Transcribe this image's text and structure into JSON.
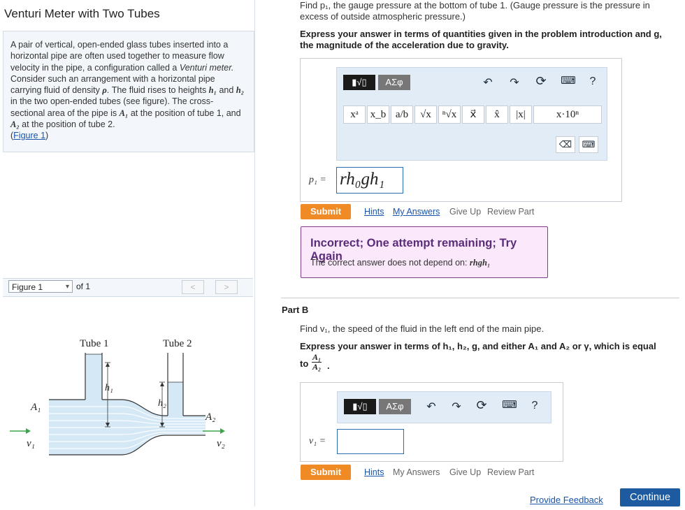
{
  "left": {
    "title": "Venturi Meter with Two Tubes",
    "intro": {
      "p1": "A pair of vertical, open-ended glass tubes inserted into a horizontal pipe are often used together to measure flow velocity in the pipe, a configuration called a ",
      "p1_italic": "Venturi meter.",
      "p2": " Consider such an arrangement with a horizontal pipe carrying fluid of density ",
      "rho": "ρ",
      "p3": ". The fluid rises to heights ",
      "h1": "h₁",
      "and": " and ",
      "h2": "h₂",
      "p4": " in the two open-ended tubes (see figure). The cross-sectional area of the pipe is ",
      "A1": "A₁",
      "p5": " at the position of tube 1, and ",
      "A2": "A₂",
      "p6": " at the position of tube 2.",
      "figure_link": "Figure 1"
    },
    "figure": {
      "selected": "Figure 1",
      "of": "of 1",
      "prev": "<",
      "next": ">",
      "tube1": "Tube 1",
      "tube2": "Tube 2",
      "h1": "h₁",
      "h2": "h₂",
      "A1": "A₁",
      "A2": "A₂",
      "v1": "v₁",
      "v2": "v₂"
    }
  },
  "partA": {
    "question": "Find p₁, the gauge pressure at the bottom of tube 1. (Gauge pressure is the pressure in excess of outside atmospheric pressure.)",
    "instruction": "Express your answer in terms of quantities given in the problem introduction and g, the magnitude of the acceleration due to gravity.",
    "toolbar_templates": "▮√▯",
    "toolbar_greek": "ΑΣφ",
    "keyboard_help": "?",
    "symbols": [
      "xᵃ",
      "x_b",
      "a/b",
      "√x",
      "ⁿ√x",
      "x⃗",
      "x̂",
      "|x|",
      "x·10ⁿ"
    ],
    "label": "p₁ =",
    "answer": "rh₀gh₁",
    "submit": "Submit",
    "links": {
      "hints": "Hints",
      "my_answers": "My Answers",
      "give_up": "Give Up",
      "review": "Review Part"
    },
    "feedback": {
      "head": "Incorrect; One attempt remaining; Try Again",
      "body": "The correct answer does not depend on: ",
      "var": "rhgh₁"
    }
  },
  "partB": {
    "title": "Part B",
    "question": "Find v₁, the speed of the fluid in the left end of the main pipe.",
    "instruction_a": "Express your answer in terms of h₁, h₂, g, and either A₁ and A₂ or γ, which is equal",
    "instruction_b": "to ",
    "frac_num": "A₁",
    "frac_den": "A₂",
    "toolbar_templates": "▮√▯",
    "toolbar_greek": "ΑΣφ",
    "keyboard_help": "?",
    "label": "v₁ =",
    "submit": "Submit",
    "links": {
      "hints": "Hints",
      "my_answers": "My Answers",
      "give_up": "Give Up",
      "review": "Review Part"
    }
  },
  "footer": {
    "feedback": "Provide Feedback",
    "continue": "Continue"
  },
  "colors": {
    "accent": "#f08a24",
    "link": "#1a54a8",
    "feedback_bg": "#fbe9fb",
    "feedback_border": "#7e3c8a",
    "continue": "#1e5aa0"
  }
}
